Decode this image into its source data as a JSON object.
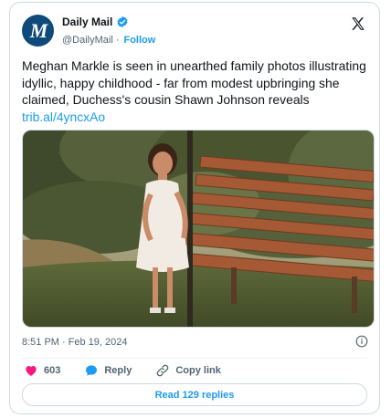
{
  "author": {
    "display_name": "Daily Mail",
    "handle": "@DailyMail",
    "separator": "·",
    "follow_label": "Follow",
    "avatar_glyph": "M",
    "verified_color": "#1d9bf0"
  },
  "tweet": {
    "text": "Meghan Markle is seen in unearthed family photos illustrating idyllic, happy childhood - far from modest upbringing she claimed, Duchess's cousin Shawn Johnson reveals ",
    "link": "trib.al/4yncxAo",
    "time": "8:51 PM",
    "separator": "·",
    "date": "Feb 19, 2024"
  },
  "actions": {
    "like_count": "603",
    "reply_label": "Reply",
    "copy_label": "Copy link"
  },
  "read_replies_label": "Read 129 replies",
  "icons": [
    "verified-badge-icon",
    "x-logo-icon",
    "info-icon",
    "heart-icon",
    "reply-bubble-icon",
    "link-icon"
  ],
  "colors": {
    "accent": "#1d9bf0",
    "like": "#f91880",
    "text": "#0f1419",
    "muted": "#536471",
    "border": "#cfd9de"
  }
}
